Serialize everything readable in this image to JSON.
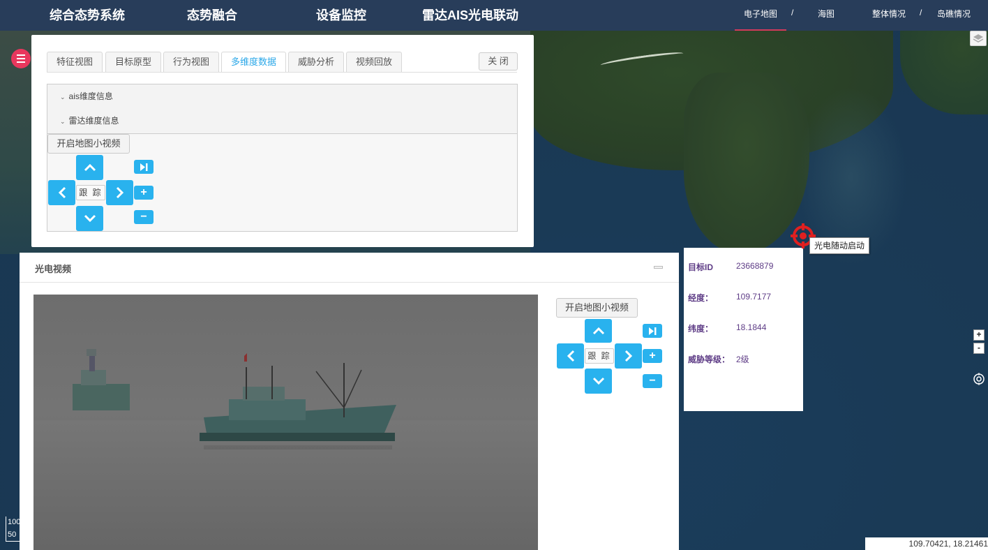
{
  "nav": {
    "main_items": [
      "综合态势系统",
      "态势融合",
      "设备监控",
      "雷达AIS光电联动"
    ],
    "map_links": [
      "电子地图",
      "海图",
      "整体情况",
      "岛礁情况"
    ],
    "separator": "/"
  },
  "detail_panel": {
    "tabs": [
      "特征视图",
      "目标原型",
      "行为视图",
      "多维度数据",
      "威胁分析",
      "视频回放"
    ],
    "active_tab": "多维度数据",
    "close_label": "关 闭",
    "accordion": [
      "ais维度信息",
      "雷达维度信息"
    ],
    "open_small_video_label": "开启地图小视频",
    "track_label": "跟 踪"
  },
  "video_panel": {
    "title": "光电视频",
    "open_small_video_label": "开启地图小视频",
    "track_label": "跟 踪"
  },
  "target_info": {
    "rows": [
      {
        "key": "目标ID",
        "value": "23668879"
      },
      {
        "key": "经度：",
        "value": "109.7177"
      },
      {
        "key": "纬度：",
        "value": "18.1844"
      },
      {
        "key": "威胁等级：",
        "value": "2级"
      }
    ]
  },
  "tooltip": "光电随动启动",
  "map": {
    "coordinates": "109.70421, 18.21461",
    "scale_top": "100",
    "scale_bottom": "50",
    "zoom_in": "+",
    "zoom_out": "-"
  },
  "colors": {
    "nav_bg": "#283d5a",
    "accent_blue": "#29b2ee",
    "active_tab": "#2aa7e8",
    "menu_red": "#e8375d",
    "info_text": "#5e3c86",
    "target_red": "#e02020"
  }
}
